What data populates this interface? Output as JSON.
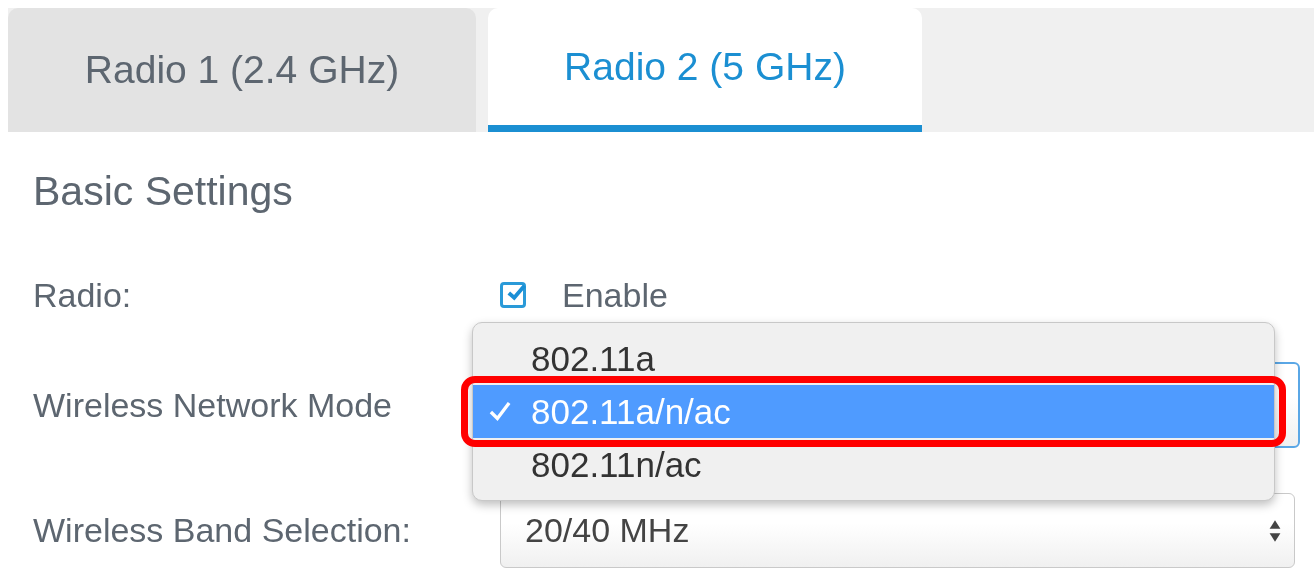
{
  "tabs": [
    {
      "label": "Radio 1 (2.4 GHz)",
      "selected": false
    },
    {
      "label": "Radio 2 (5 GHz)",
      "selected": true
    }
  ],
  "section_title": "Basic Settings",
  "fields": [
    {
      "kind": "checkbox",
      "label": "Radio:",
      "checked": true,
      "option_label": "Enable"
    },
    {
      "kind": "select",
      "label": "Wireless Network Mode",
      "open": true,
      "options": [
        {
          "label": "802.11a",
          "selected": false,
          "highlighted": false
        },
        {
          "label": "802.11a/n/ac",
          "selected": true,
          "highlighted": true
        },
        {
          "label": "802.11n/ac",
          "selected": false,
          "highlighted": false
        }
      ]
    },
    {
      "kind": "select",
      "label": "Wireless Band Selection:",
      "value": "20/40 MHz"
    }
  ]
}
